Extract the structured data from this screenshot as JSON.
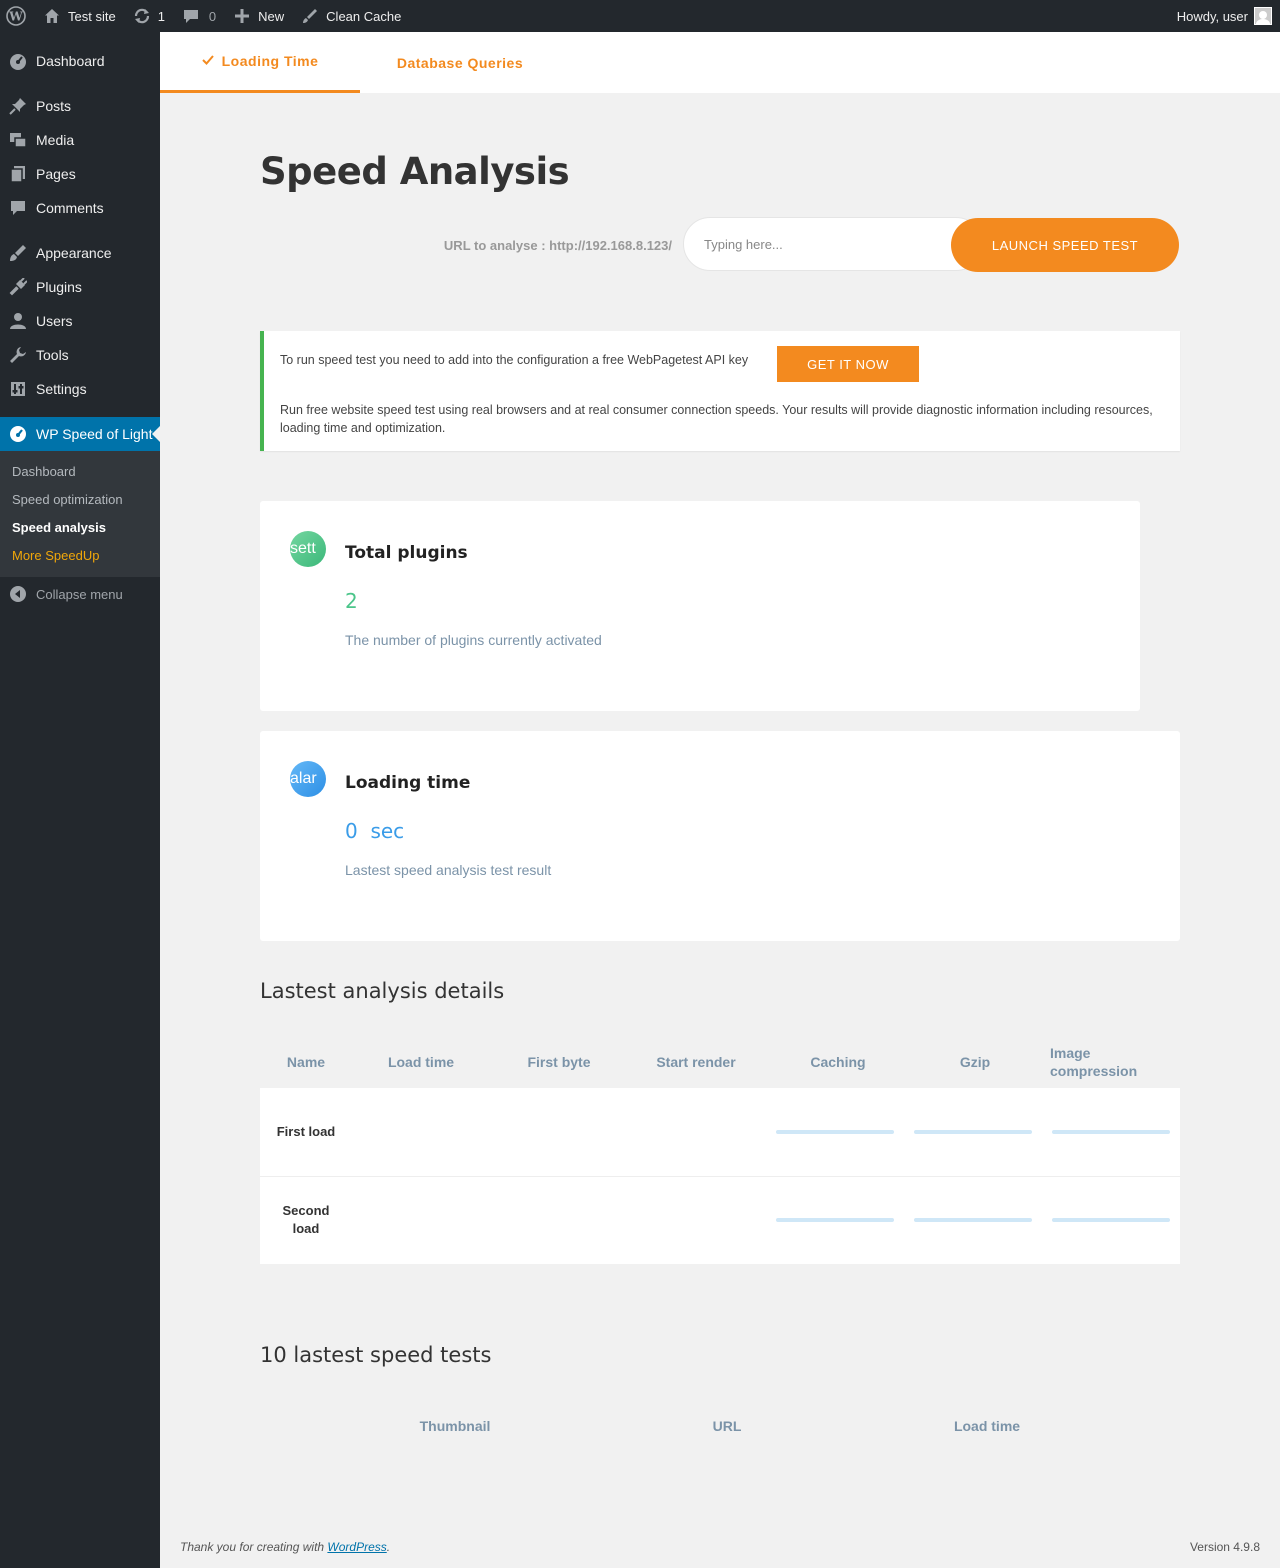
{
  "adminbar": {
    "site_name": "Test site",
    "updates_count": "1",
    "comments_count": "0",
    "new_label": "New",
    "clean_cache_label": "Clean Cache",
    "howdy": "Howdy, user"
  },
  "sidebar": {
    "items": [
      {
        "label": "Dashboard"
      },
      {
        "label": "Posts"
      },
      {
        "label": "Media"
      },
      {
        "label": "Pages"
      },
      {
        "label": "Comments"
      },
      {
        "label": "Appearance"
      },
      {
        "label": "Plugins"
      },
      {
        "label": "Users"
      },
      {
        "label": "Tools"
      },
      {
        "label": "Settings"
      },
      {
        "label": "WP Speed of Light"
      }
    ],
    "submenu": [
      {
        "label": "Dashboard"
      },
      {
        "label": "Speed optimization"
      },
      {
        "label": "Speed analysis"
      },
      {
        "label": "More SpeedUp"
      }
    ],
    "collapse": "Collapse menu"
  },
  "tabs": [
    {
      "label": "Loading Time"
    },
    {
      "label": "Database Queries"
    }
  ],
  "main": {
    "title": "Speed Analysis",
    "url_label": "URL to analyse : http://192.168.8.123/",
    "search_placeholder": "Typing here...",
    "launch_label": "LAUNCH SPEED TEST"
  },
  "notice": {
    "line1": "To run speed test you need to add into the configuration a free WebPagetest API key",
    "button": "GET IT NOW",
    "line2": "Run free website speed test using real browsers and at real consumer connection speeds. Your results will provide diagnostic information including resources, loading time and optimization."
  },
  "cards": {
    "plugins": {
      "icon_text": "sett",
      "title": "Total plugins",
      "value": "2",
      "desc": "The number of plugins currently activated"
    },
    "loading": {
      "icon_text": "alar",
      "title": "Loading time",
      "value": "0",
      "unit": "sec",
      "desc": "Lastest speed analysis test result"
    }
  },
  "details": {
    "title": "Lastest analysis details",
    "headers": [
      "Name",
      "Load time",
      "First byte",
      "Start render",
      "Caching",
      "Gzip",
      "Image compression"
    ],
    "rows": [
      {
        "name": "First load",
        "caching": 0,
        "gzip": 0,
        "image_compression": 0
      },
      {
        "name": "Second load",
        "caching": 0,
        "gzip": 0,
        "image_compression": 0
      }
    ]
  },
  "tests": {
    "title": "10 lastest speed tests",
    "headers": [
      "Thumbnail",
      "URL",
      "Load time"
    ]
  },
  "footer": {
    "thanks_prefix": "Thank you for creating with ",
    "wordpress_link": "WordPress",
    "thanks_suffix": ".",
    "version": "Version 4.9.8"
  }
}
